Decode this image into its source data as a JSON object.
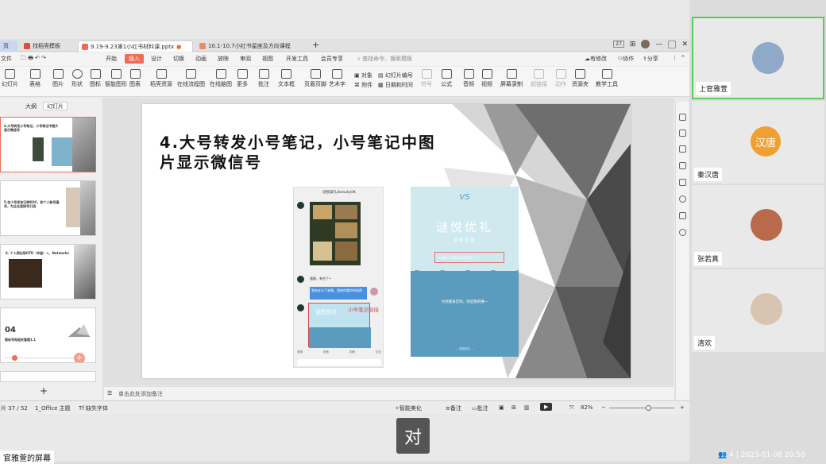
{
  "tabs": [
    {
      "label": "页",
      "active": false
    },
    {
      "label": "找稻壳模板",
      "active": false
    },
    {
      "label": "9.19-9.23第1小红书材料课.pptx",
      "active": true
    },
    {
      "label": "10.1-10.7小红书星座及方向课程",
      "active": false
    }
  ],
  "tab_counter": "27",
  "menu": {
    "file": "文件",
    "items": [
      "开始",
      "插入",
      "设计",
      "切换",
      "动画",
      "放映",
      "审阅",
      "视图",
      "开发工具",
      "会员专享"
    ],
    "active": "插入",
    "search_placeholder": "查找命令、搜索模板",
    "right_items": [
      "有修改",
      "协作",
      "分享"
    ]
  },
  "ribbon": [
    {
      "label": "幻灯片",
      "grey": false
    },
    {
      "label": "表格",
      "grey": false
    },
    {
      "label": "图片",
      "grey": false
    },
    {
      "label": "形状",
      "grey": false
    },
    {
      "label": "图标",
      "grey": false
    },
    {
      "label": "智能图形",
      "grey": false
    },
    {
      "label": "图表",
      "grey": false
    },
    {
      "label": "稻壳资源",
      "grey": false
    },
    {
      "label": "在线流程图",
      "grey": false
    },
    {
      "label": "在线脑图",
      "grey": false
    },
    {
      "label": "更多",
      "grey": false
    },
    {
      "label": "批注",
      "grey": false
    },
    {
      "label": "文本框",
      "grey": false
    },
    {
      "label": "页眉页脚",
      "grey": false
    },
    {
      "label": "艺术字",
      "grey": false
    },
    {
      "label": "符号",
      "grey": true
    },
    {
      "label": "公式",
      "grey": false
    },
    {
      "label": "音频",
      "grey": false
    },
    {
      "label": "视频",
      "grey": false
    },
    {
      "label": "屏幕录制",
      "grey": false
    },
    {
      "label": "超链接",
      "grey": true
    },
    {
      "label": "动作",
      "grey": true
    },
    {
      "label": "资源夹",
      "grey": false
    },
    {
      "label": "教学工具",
      "grey": false
    }
  ],
  "ribbon_small": {
    "object": "对象",
    "slide_number": "幻灯片编号",
    "attachment": "附件",
    "datetime": "日期和时间"
  },
  "panel": {
    "tabs": [
      "大纲",
      "幻灯片"
    ],
    "thumbs": [
      {
        "text": "4.大号转发小号笔记，小号笔记中图片显示微信号",
        "selected": true
      },
      {
        "text": "5.在小号发布已转KOC，和个人账号最关，为企业直接号引流",
        "selected": false
      },
      {
        "text": "6. 个人网出现OTD（作者）+。Networks",
        "selected": false
      },
      {
        "number": "04",
        "text": "图标号和相关管理1.1",
        "selected": false
      }
    ],
    "add_label": "+"
  },
  "slide": {
    "title": "4.大号转发小号笔记，小号笔记中图片显示微信号",
    "phone": {
      "header": "谜悦美礼/beautyOK",
      "msg1": "唐唐，有空了~",
      "msg2": "我有在么下来哦，我给你看你的选择",
      "card_text": "谜悦优礼",
      "annotation": "小号笔记链接",
      "bottom": [
        "表情",
        "语音",
        "相册",
        "红包"
      ]
    },
    "poster": {
      "logo": "VS",
      "brand": "谜悦优礼",
      "subtitle": "定制咨询",
      "wechat": "+电话：18012345678",
      "slogan": "为你量身定制，你是我的唯一",
      "footer": "— 谜悦优礼 —"
    }
  },
  "notes_placeholder": "单击此处添加备注",
  "status": {
    "slide_index": "片 37 / 52",
    "theme": "1_Office 主题",
    "missing_font": "缺失字体",
    "smart_beautify": "智能美化",
    "notes": "备注",
    "comment": "批注",
    "zoom": "82%",
    "zoom_level": 0.6
  },
  "participants": [
    {
      "name": "上官雅萱",
      "selected": true,
      "avatar_text": "",
      "color": "#8fa9c9"
    },
    {
      "name": "秦汉唐",
      "selected": false,
      "avatar_text": "汉唐",
      "color": "#f0a030"
    },
    {
      "name": "张若真",
      "selected": false,
      "avatar_text": "",
      "color": "#b86a4a"
    },
    {
      "name": "清欢",
      "selected": false,
      "avatar_text": "",
      "color": "#d8c4b0"
    }
  ],
  "bottom_bar": {
    "count": "4",
    "datetime": "2023-01-08 20:50"
  },
  "share_label": "官雅萱的屏幕",
  "subtitle": "对",
  "colors": {
    "accent": "#f06a54",
    "selected_border": "#5cc95c",
    "poster_blue": "#5b9bbd",
    "poster_light": "#cfe9ef"
  }
}
